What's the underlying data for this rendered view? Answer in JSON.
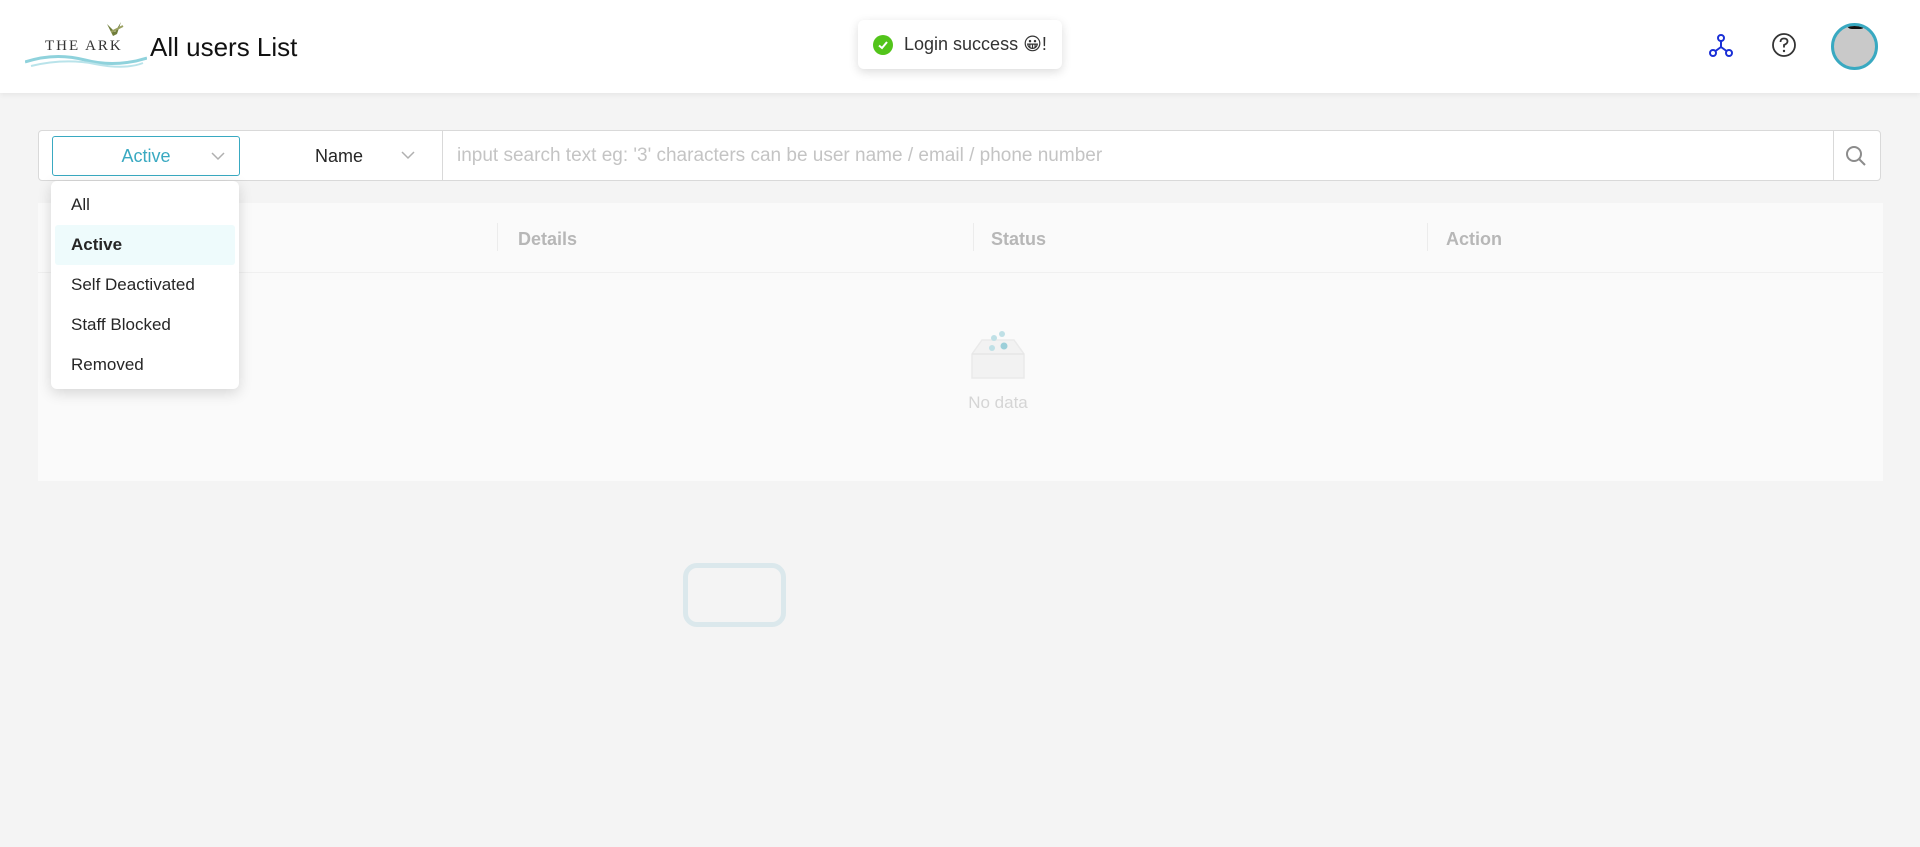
{
  "header": {
    "logo_text": "THE ARK",
    "title": "All users List"
  },
  "toast": {
    "message": "Login success 😀!",
    "status_color": "#52c41a"
  },
  "header_icons": {
    "network": "network-icon",
    "help": "help-icon",
    "avatar": "avatar"
  },
  "filters": {
    "status_selected": "Active",
    "field_selected": "Name",
    "search_placeholder": "input search text eg: '3' characters can be user name / email / phone number",
    "accent_color": "#39a9c1"
  },
  "status_options": [
    {
      "label": "All",
      "selected": false
    },
    {
      "label": "Active",
      "selected": true
    },
    {
      "label": "Self Deactivated",
      "selected": false
    },
    {
      "label": "Staff Blocked",
      "selected": false
    },
    {
      "label": "Removed",
      "selected": false
    }
  ],
  "table": {
    "columns": [
      "",
      "Details",
      "Status",
      "Action"
    ],
    "empty_text": "No data"
  }
}
